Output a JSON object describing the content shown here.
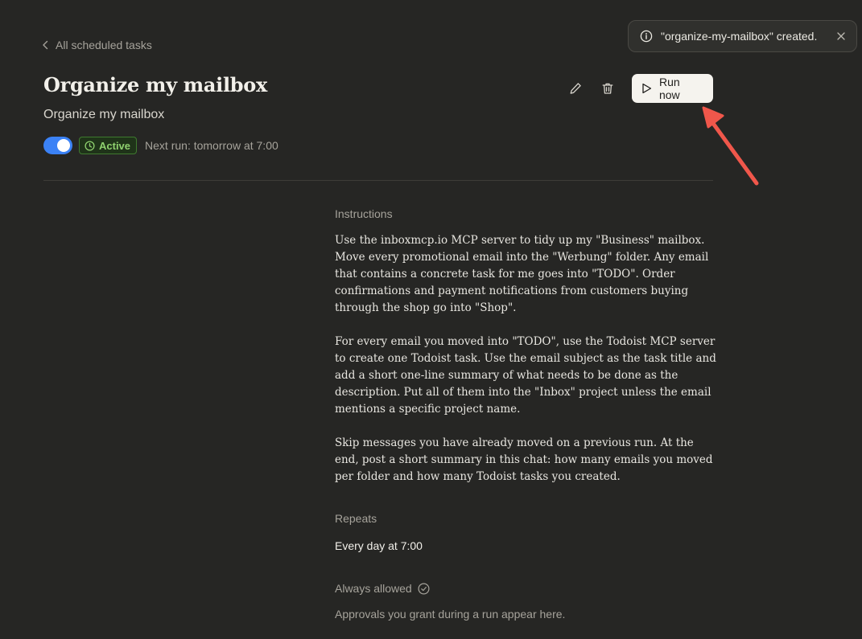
{
  "nav": {
    "back_label": "All scheduled tasks"
  },
  "task": {
    "title": "Organize my mailbox",
    "subtitle": "Organize my mailbox",
    "status_badge": "Active",
    "next_run": "Next run: tomorrow at 7:00",
    "toggle_on": true
  },
  "actions": {
    "run_label": "Run now"
  },
  "toast": {
    "message": "\"organize-my-mailbox\" created."
  },
  "sections": {
    "instructions_label": "Instructions",
    "instructions": [
      "Use the inboxmcp.io MCP server to tidy up my \"Business\" mailbox. Move every promotional email into the \"Werbung\" folder. Any email that contains a concrete task for me goes into \"TODO\". Order confirmations and payment notifications from customers buying through the shop go into \"Shop\".",
      "For every email you moved into \"TODO\", use the Todoist MCP server to create one Todoist task. Use the email subject as the task title and add a short one-line summary of what needs to be done as the description. Put all of them into the \"Inbox\" project unless the email mentions a specific project name.",
      "Skip messages you have already moved on a previous run. At the end, post a short summary in this chat: how many emails you moved per folder and how many Todoist tasks you created."
    ],
    "repeats_label": "Repeats",
    "repeats_value": "Every day at 7:00",
    "allowed_label": "Always allowed",
    "allowed_hint": "Approvals you grant during a run appear here."
  },
  "colors": {
    "background": "#262624",
    "toggle": "#3b82f6",
    "badge_text": "#8fd16f",
    "annotation_arrow": "#f0574b"
  },
  "icons": [
    "chevron-left-icon",
    "clock-icon",
    "pencil-icon",
    "trash-icon",
    "play-icon",
    "info-icon",
    "close-icon",
    "check-circle-icon"
  ]
}
